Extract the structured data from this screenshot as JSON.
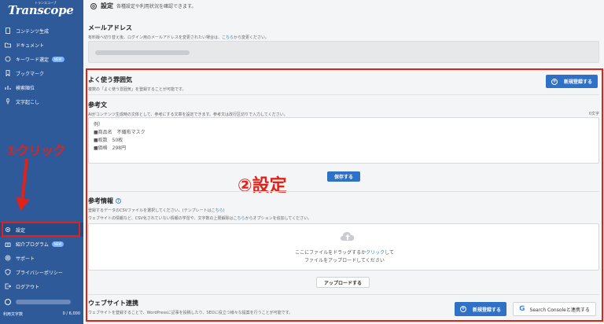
{
  "sidebar": {
    "logo": "Transcope",
    "logo_sub": "トランスコープ",
    "items": [
      {
        "label": "コンテンツ生成",
        "icon": "document-icon"
      },
      {
        "label": "ドキュメント",
        "icon": "folder-icon"
      },
      {
        "label": "キーワード選定",
        "icon": "keyword-icon",
        "badge": "NEW"
      },
      {
        "label": "ブックマーク",
        "icon": "bookmark-icon"
      },
      {
        "label": "検索順位",
        "icon": "chart-icon"
      },
      {
        "label": "文字起こし",
        "icon": "microphone-icon"
      }
    ],
    "bottom_items": [
      {
        "label": "設定",
        "icon": "gear-icon"
      },
      {
        "label": "紹介プログラム",
        "icon": "gift-icon",
        "badge": "NEW"
      },
      {
        "label": "サポート",
        "icon": "support-icon"
      },
      {
        "label": "プライバシーポリシー",
        "icon": "shield-icon"
      },
      {
        "label": "ログアウト",
        "icon": "logout-icon"
      }
    ],
    "usage_label": "利用文字数",
    "usage_value": "0 / 6,000",
    "annotation_click": "①クリック"
  },
  "header": {
    "title": "設定",
    "desc": "各種設定や利用状況を確認できます。"
  },
  "email": {
    "title": "メールアドレス",
    "desc_prefix": "有料版へ切り替え後、ログイン用のメールアドレスを変更されたい場合は、",
    "desc_link": "こちら",
    "desc_suffix": "から変更ください。"
  },
  "tone": {
    "title": "よく使う雰囲気",
    "desc": "複数の「よく使う雰囲気」を登録することが可能です。",
    "button": "新規登録する"
  },
  "reference_text": {
    "title": "参考文",
    "desc": "AIがコンテンツ生成時の文体として、参考にする文章を設定できます。参考文は改行区切りで入力してください。",
    "char_count": "0文字",
    "lines": [
      "例）",
      "■商品名　不織布マスク",
      "■枚数　50枚",
      "■価格　298円"
    ],
    "save_button": "保存する"
  },
  "annotation_setting": "②設定",
  "reference_info": {
    "title": "参考情報",
    "desc1_prefix": "登録するデータのCSVファイルを選択してください。(テンプレートは",
    "desc1_link": "こちら",
    "desc1_suffix": ")",
    "desc2_prefix": "ウェブサイトの情報など、CSV化されていない情報の学習や、文字数の上限解除は",
    "desc2_link": "こちら",
    "desc2_suffix": "からオプションを追加してください。",
    "upload_line1_prefix": "ここにファイルをドラッグするか",
    "upload_line1_link": "クリック",
    "upload_line1_suffix": "して",
    "upload_line2": "ファイルをアップロードしてください",
    "upload_button": "アップロードする"
  },
  "website": {
    "title": "ウェブサイト連携",
    "desc": "ウェブサイトを登録することで、WordPressに記事を投稿したり、SEOに役立つ様々な提案を行うことが可能です。",
    "button": "新規登録する",
    "sc_button": "Search Consoleと連携する",
    "sc_icon_letter": "G"
  },
  "colors": {
    "sidebar_bg": "#2f5a9a",
    "accent": "#2f71c6",
    "annotation": "#e0231a"
  }
}
